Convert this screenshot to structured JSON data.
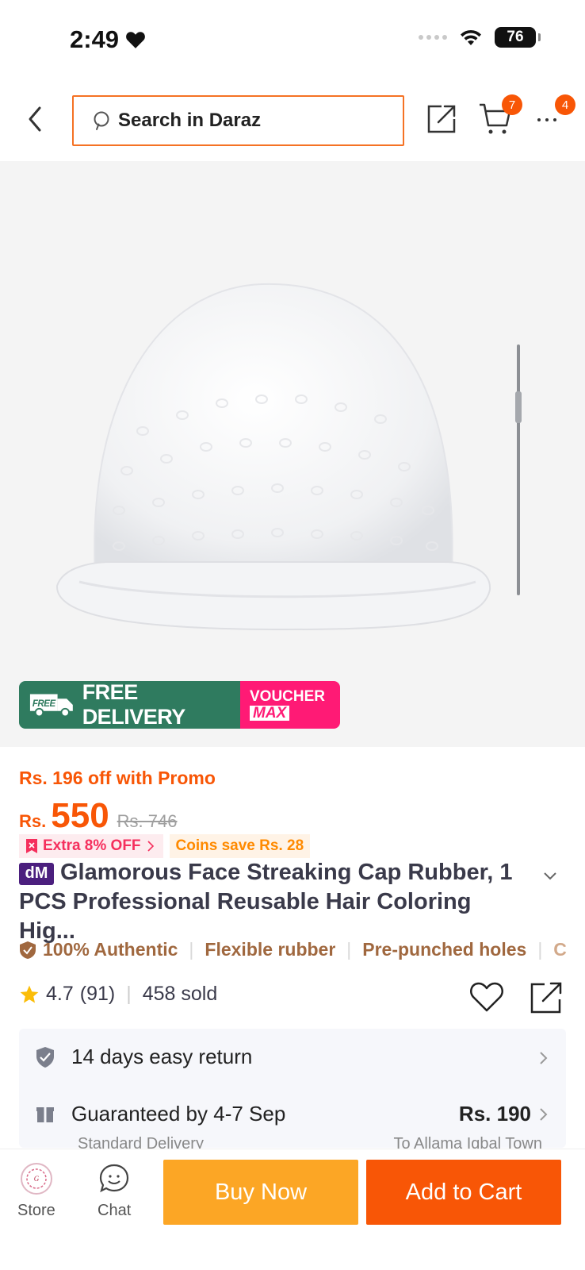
{
  "status_bar": {
    "time": "2:49",
    "battery": "76"
  },
  "header": {
    "search_placeholder": "Search in Daraz",
    "cart_count": "7",
    "more_count": "4"
  },
  "banner": {
    "free_delivery": "FREE DELIVERY",
    "free_tag": "FREE",
    "voucher_line1": "VOUCHER",
    "voucher_line2": "MAX"
  },
  "price": {
    "promo_text": "Rs. 196 off with Promo",
    "currency": "Rs.",
    "value": "550",
    "old_price": "Rs. 746",
    "extra_off": "Extra 8% OFF",
    "coins": "Coins save Rs. 28"
  },
  "product": {
    "brand_tag": "dM",
    "title": "Glamorous Face Streaking Cap Rubber, 1 PCS Professional Reusable Hair Coloring Hig..."
  },
  "features": [
    "100% Authentic",
    "Flexible rubber",
    "Pre-punched holes",
    "C"
  ],
  "rating": {
    "score": "4.7",
    "count": "(91)",
    "sold": "458 sold"
  },
  "services": {
    "return": "14 days easy return",
    "delivery": "Guaranteed by 4-7 Sep",
    "delivery_price": "Rs. 190",
    "delivery_sub": "Standard Delivery",
    "delivery_to": "To Allama Iqbal Town"
  },
  "bottom": {
    "store": "Store",
    "chat": "Chat",
    "buy_now": "Buy Now",
    "add_to_cart": "Add to Cart"
  },
  "colors": {
    "accent": "#f85606",
    "buy_now": "#fca625",
    "banner_green": "#2f7b5f",
    "banner_pink": "#ff1a75"
  }
}
